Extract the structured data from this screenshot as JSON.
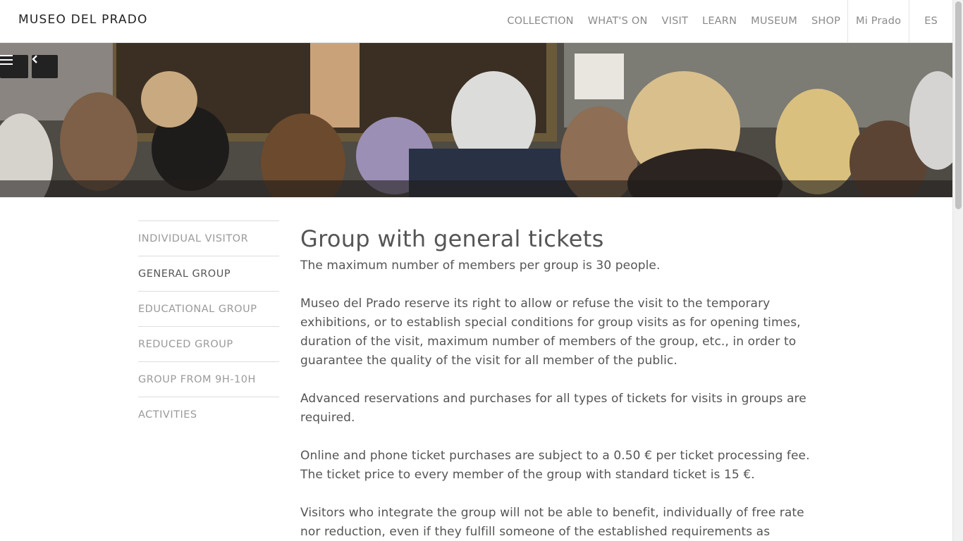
{
  "header": {
    "logo": "MUSEO DEL PRADO",
    "nav": [
      "COLLECTION",
      "WHAT'S ON",
      "VISIT",
      "LEARN",
      "MUSEUM",
      "SHOP"
    ],
    "account": "Mi Prado",
    "language": "ES"
  },
  "hero": {
    "menu_icon": "hamburger-menu-icon",
    "back_icon": "chevron-left-icon"
  },
  "sidebar": {
    "items": [
      {
        "label": "INDIVIDUAL VISITOR",
        "active": false
      },
      {
        "label": "GENERAL GROUP",
        "active": true
      },
      {
        "label": "EDUCATIONAL GROUP",
        "active": false
      },
      {
        "label": "REDUCED GROUP",
        "active": false
      },
      {
        "label": "GROUP FROM 9H-10H",
        "active": false
      },
      {
        "label": "ACTIVITIES",
        "active": false
      }
    ]
  },
  "main": {
    "title": "Group with general tickets",
    "paragraphs": [
      "The maximum number of members per group is 30 people.",
      "Museo del Prado reserve its right to allow or refuse the visit to the temporary exhibitions, or to establish special conditions for group visits as for opening times, duration of the visit, maximum number of members of the group, etc., in order to guarantee the quality of the visit for all member of the public.",
      "Advanced reservations and purchases for all types of tickets for visits in groups are required.",
      "Online and phone ticket purchases are subject to a 0.50 € per ticket processing fee. The ticket price to every member of the group with standard ticket is 15 €.",
      "Visitors who integrate the group will not be able to benefit, individually of free rate nor reduction, even if they fulfill someone of the established requirements as"
    ]
  },
  "colors": {
    "text": "#555555",
    "nav_text": "#8a8a8a",
    "sidebar_inactive": "#9a9a9a",
    "divider": "#dddddd",
    "button_bg": "#222222"
  }
}
